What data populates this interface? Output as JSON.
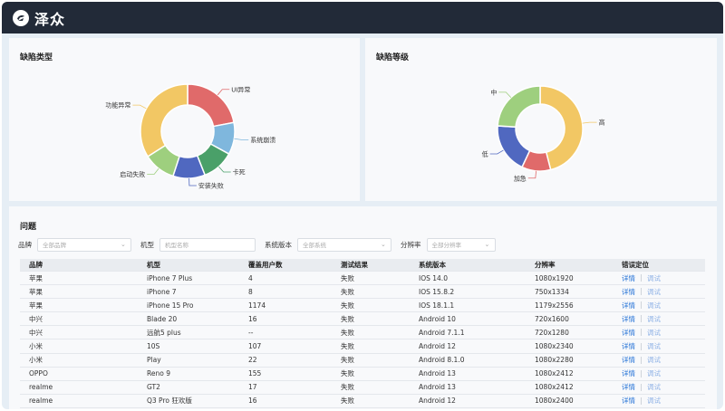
{
  "app": {
    "logo_icon": "zezhong-logo-icon",
    "title": "泽众"
  },
  "defect_type_card": {
    "title": "缺陷类型",
    "slices": [
      {
        "label": "UI异常",
        "value": 22,
        "color": "#e06a6a"
      },
      {
        "label": "系统崩溃",
        "value": 11,
        "color": "#7fb7dd"
      },
      {
        "label": "卡死",
        "value": 11,
        "color": "#4aa069"
      },
      {
        "label": "安装失败",
        "value": 11,
        "color": "#5068c0"
      },
      {
        "label": "启动失败",
        "value": 11,
        "color": "#9ecf7e"
      },
      {
        "label": "功能异常",
        "value": 34,
        "color": "#f2c764"
      }
    ]
  },
  "defect_level_card": {
    "title": "缺陷等级",
    "slices": [
      {
        "label": "高",
        "value": 46,
        "color": "#f2c764"
      },
      {
        "label": "加急",
        "value": 11,
        "color": "#e06a6a"
      },
      {
        "label": "低",
        "value": 19,
        "color": "#5068c0"
      },
      {
        "label": "中",
        "value": 24,
        "color": "#9ecf7e"
      }
    ]
  },
  "issues": {
    "title": "问题",
    "filters": {
      "brand_label": "品牌",
      "brand_value": "全部品牌",
      "model_label": "机型",
      "model_placeholder": "机型名称",
      "os_label": "系统版本",
      "os_value": "全部系统",
      "res_label": "分辨率",
      "res_value": "全部分辨率"
    },
    "columns": [
      "品牌",
      "机型",
      "覆盖用户数",
      "测试结果",
      "系统版本",
      "分辨率",
      "错误定位"
    ],
    "action_detail": "详情",
    "action_debug": "调试",
    "rows": [
      [
        "苹果",
        "iPhone 7 Plus",
        "4",
        "失败",
        "IOS 14.0",
        "1080x1920"
      ],
      [
        "苹果",
        "iPhone 7",
        "8",
        "失败",
        "IOS 15.8.2",
        "750x1334"
      ],
      [
        "苹果",
        "iPhone 15 Pro",
        "1174",
        "失败",
        "IOS 18.1.1",
        "1179x2556"
      ],
      [
        "中兴",
        "Blade 20",
        "16",
        "失败",
        "Android 10",
        "720x1600"
      ],
      [
        "中兴",
        "远航5 plus",
        "--",
        "失败",
        "Android 7.1.1",
        "720x1280"
      ],
      [
        "小米",
        "10S",
        "107",
        "失败",
        "Android 12",
        "1080x2340"
      ],
      [
        "小米",
        "Play",
        "22",
        "失败",
        "Android 8.1.0",
        "1080x2280"
      ],
      [
        "OPPO",
        "Reno 9",
        "155",
        "失败",
        "Android 13",
        "1080x2412"
      ],
      [
        "realme",
        "GT2",
        "17",
        "失败",
        "Android 13",
        "1080x2412"
      ],
      [
        "realme",
        "Q3 Pro 狂欢版",
        "16",
        "失败",
        "Android 12",
        "1080x2400"
      ]
    ]
  }
}
